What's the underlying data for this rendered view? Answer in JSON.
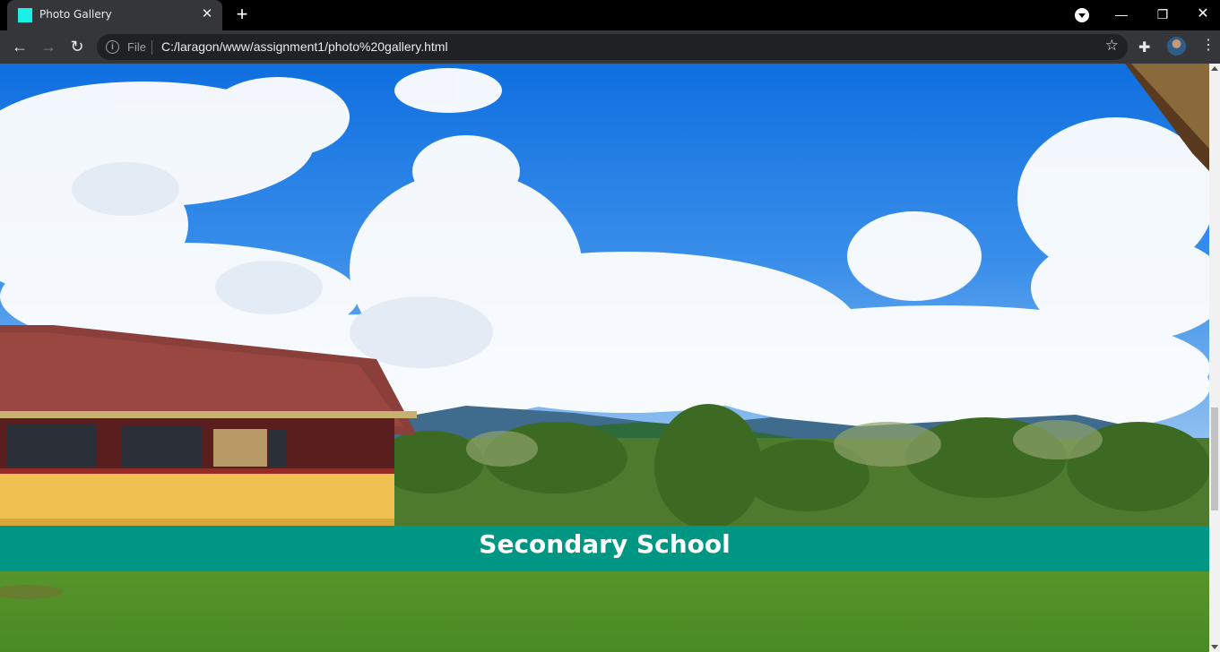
{
  "browser": {
    "tab": {
      "title": "Photo Gallery",
      "favicon_color": "#19f0e8"
    },
    "address_bar": {
      "scheme_label": "File",
      "url": "C:/laragon/www/assignment1/photo%20gallery.html"
    }
  },
  "page": {
    "caption": "Secondary School",
    "caption_bg": "#009684"
  }
}
